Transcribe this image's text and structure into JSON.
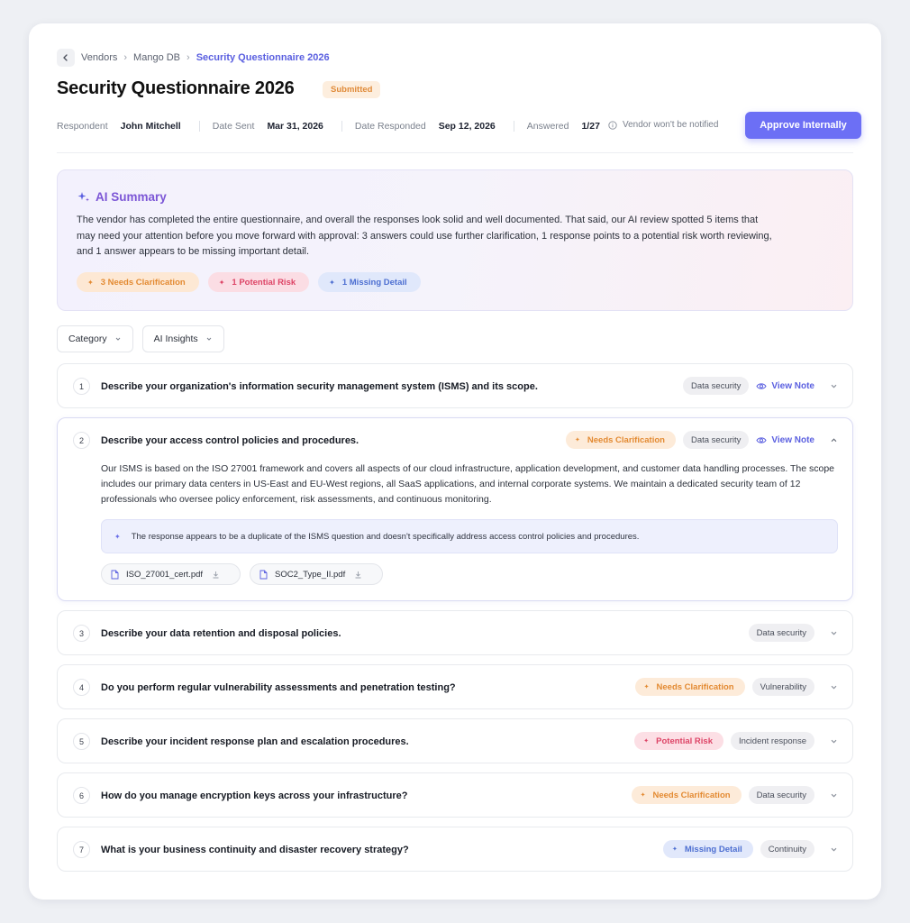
{
  "breadcrumb": {
    "items": [
      "Vendors",
      "Mango DB"
    ],
    "current": "Security Questionnaire 2026",
    "sep": "›"
  },
  "header": {
    "title": "Security Questionnaire 2026",
    "status": "Submitted"
  },
  "meta": {
    "respondent_label": "Respondent",
    "respondent": "John Mitchell",
    "date_sent_label": "Date Sent",
    "date_sent": "Mar 31, 2026",
    "date_responded_label": "Date Responded",
    "date_responded": "Sep 12, 2026",
    "answered_label": "Answered",
    "answered": "1/27",
    "notify_text": "Vendor won't be notified",
    "approve_label": "Approve Internally"
  },
  "ai_summary": {
    "title": "AI Summary",
    "text": "The vendor has completed the entire questionnaire, and overall the responses look solid and well documented. That said, our AI review spotted 5 items that may need your attention before you move forward with approval: 3 answers could use further clarification, 1 response points to a potential risk worth reviewing, and 1 answer appears to be missing important detail.",
    "chips": {
      "clarification": "3 Needs Clarification",
      "risk": "1 Potential Risk",
      "missing": "1 Missing Detail"
    }
  },
  "filters": {
    "category": "Category",
    "ai_insights": "AI Insights"
  },
  "questions": [
    {
      "num": "1",
      "text": "Describe your organization's information security management system (ISMS) and its scope.",
      "tag": "Data security",
      "view_note": "View Note"
    },
    {
      "num": "2",
      "text": "Describe your access control policies and procedures.",
      "insight": "Needs Clarification",
      "tag": "Data security",
      "view_note": "View Note",
      "answer": "Our ISMS is based on the ISO 27001 framework and covers all aspects of our cloud infrastructure, application development, and customer data handling processes. The scope includes our primary data centers in US-East and EU-West regions, all SaaS applications, and internal corporate systems. We maintain a dedicated security team of 12 professionals who oversee policy enforcement, risk assessments, and continuous monitoring.",
      "ai_note": "The response appears to be a duplicate of the ISMS question and doesn't specifically address access control policies and procedures.",
      "files": [
        "ISO_27001_cert.pdf",
        "SOC2_Type_II.pdf"
      ]
    },
    {
      "num": "3",
      "text": "Describe your data retention and disposal policies.",
      "tag": "Data security"
    },
    {
      "num": "4",
      "text": "Do you perform regular vulnerability assessments and penetration testing?",
      "insight": "Needs Clarification",
      "tag": "Vulnerability"
    },
    {
      "num": "5",
      "text": "Describe your incident response plan and escalation procedures.",
      "insight": "Potential Risk",
      "tag": "Incident response"
    },
    {
      "num": "6",
      "text": "How do you manage encryption keys across your infrastructure?",
      "insight": "Needs Clarification",
      "tag": "Data security"
    },
    {
      "num": "7",
      "text": "What is your business continuity and disaster recovery strategy?",
      "insight": "Missing Detail",
      "tag": "Continuity"
    }
  ],
  "colors": {
    "accent": "#6c6ff5",
    "orange": "#e38a32",
    "red": "#dd4466",
    "blue": "#4d6fd1"
  },
  "icons": {
    "back": "chevron-left-icon",
    "info": "info-icon",
    "sparkle": "sparkle-icon",
    "eye": "eye-icon",
    "file": "file-icon",
    "download": "download-icon",
    "chevron": "chevron-down-icon"
  }
}
